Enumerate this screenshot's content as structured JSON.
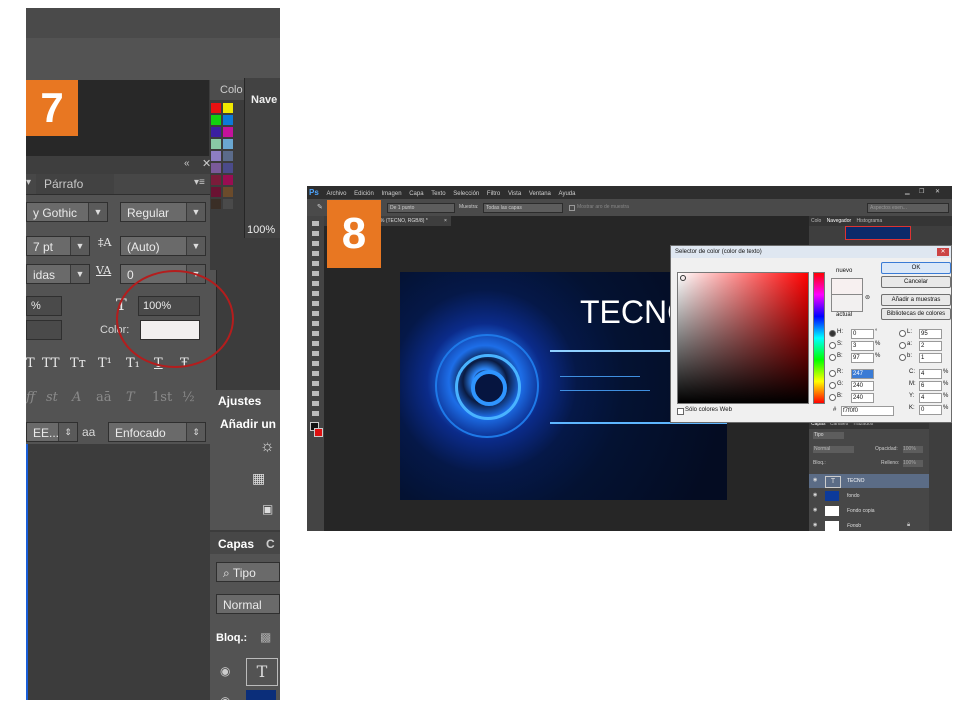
{
  "panel7": {
    "step": "7",
    "color_tab": "Colo",
    "nav_tab": "Nave",
    "nav_zoom": "100%",
    "paragraph_tab": "Párrafo",
    "font_family": "y Gothic",
    "font_style": "Regular",
    "font_size": "7 pt",
    "leading": "(Auto)",
    "kerning": "idas",
    "tracking": "0",
    "scale_left": "%",
    "scale_right": "100%",
    "color_label": "Color:",
    "text_color": "#f2f0f0",
    "style_glyphs": [
      "T",
      "TT",
      "Tт",
      "T¹",
      "T₁",
      "T",
      "Ŧ"
    ],
    "opentype_glyphs": [
      "ﬀ",
      "st",
      "A",
      "aā",
      "T",
      "1st",
      "½"
    ],
    "language": "EE...",
    "aa_label": "aa",
    "antialias": "Enfocado",
    "ajustes_tab": "Ajustes",
    "ajustes_add": "Añadir un",
    "capas_tab": "Capas",
    "capas_tab2": "C",
    "filter_kind": "Tipo",
    "blend_mode": "Normal",
    "lock_label": "Bloq.:",
    "layer_thumb": "T"
  },
  "panel8": {
    "step": "8",
    "logo": "Ps",
    "menu": [
      "Archivo",
      "Edición",
      "Imagen",
      "Capa",
      "Texto",
      "Selección",
      "Filtro",
      "Vista",
      "Ventana",
      "Ayuda"
    ],
    "options": {
      "sample_size": "De 1 punto",
      "sample_label": "Muestra:",
      "sample_value": "Todas las capas",
      "ring_label": "Mostrar aro de muestra",
      "workspace": "Aspectos esen..."
    },
    "doc_tab": "% (TECNO, RGB/8) *",
    "canvas_title": "TECNO",
    "right_tabs": [
      "Colo",
      "Navegador",
      "Histograma"
    ],
    "layers": {
      "tabs": [
        "Capas",
        "Canales",
        "Trazados"
      ],
      "kind": "Tipo",
      "blend": "Normal",
      "opacity_label": "Opacidad:",
      "opacity": "100%",
      "lock_label": "Bloq.:",
      "fill_label": "Relleno:",
      "fill": "100%",
      "items": [
        {
          "name": "TECNO",
          "thumb": "T"
        },
        {
          "name": "fondo",
          "thumb": ""
        },
        {
          "name": "Fondo copia",
          "thumb": ""
        },
        {
          "name": "Fondo",
          "thumb": ""
        }
      ]
    },
    "dialog": {
      "title": "Selector de color (color de texto)",
      "new_label": "nuevo",
      "current_label": "actual",
      "buttons": [
        "OK",
        "Cancelar",
        "Añadir a muestras",
        "Bibliotecas de colores"
      ],
      "fields": {
        "H": "0",
        "S": "3",
        "B": "97",
        "R": "247",
        "G": "240",
        "Bv": "240",
        "L": "95",
        "a": "2",
        "b": "1",
        "C": "4",
        "M": "6",
        "Y": "4",
        "K": "0"
      },
      "units": {
        "deg": "°",
        "pct": "%"
      },
      "hex_label": "#",
      "hex": "f7f0f0",
      "web_only": "Sólo colores Web"
    }
  }
}
